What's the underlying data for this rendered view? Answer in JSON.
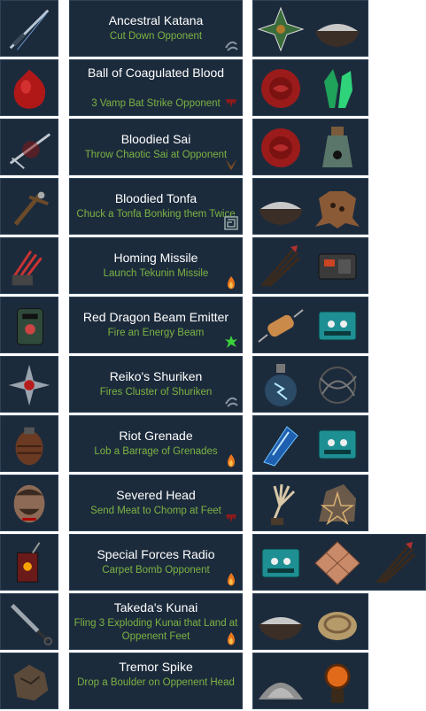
{
  "recipes": [
    {
      "name": "Ancestral Katana",
      "desc": "Cut Down Opponent",
      "icon": "katana-icon",
      "element": "wind-icon",
      "ingredients": [
        "shuriken-star-icon",
        "salt-bowl-icon"
      ]
    },
    {
      "name": "Ball of Coagulated Blood",
      "desc": "3 Vamp Bat Strike Opponent",
      "icon": "blood-ball-icon",
      "element": "blood-icon",
      "ingredients": [
        "wax-seal-icon",
        "green-crystal-icon"
      ]
    },
    {
      "name": "Bloodied Sai",
      "desc": "Throw Chaotic Sai at Opponent",
      "icon": "sai-icon",
      "element": "horns-icon",
      "ingredients": [
        "wax-seal-icon",
        "bottled-spider-icon"
      ]
    },
    {
      "name": "Bloodied Tonfa",
      "desc": "Chuck a Tonfa Bonking them Twice",
      "icon": "tonfa-icon",
      "element": "maze-icon",
      "ingredients": [
        "salt-bowl-icon",
        "animal-pelt-icon"
      ]
    },
    {
      "name": "Homing Missile",
      "desc": "Launch Tekunin Missile",
      "icon": "claws-icon",
      "element": "fire-icon",
      "ingredients": [
        "arrows-bundle-icon",
        "metal-device-icon"
      ]
    },
    {
      "name": "Red Dragon Beam Emitter",
      "desc": "Fire an Energy Beam",
      "icon": "emitter-device-icon",
      "element": "acid-icon",
      "ingredients": [
        "resistor-icon",
        "circuit-board-icon"
      ]
    },
    {
      "name": "Reiko's Shuriken",
      "desc": "Fires Cluster of Shuriken",
      "icon": "shuriken-icon",
      "element": "wind-icon",
      "ingredients": [
        "lightning-flask-icon",
        "tangled-wire-icon"
      ]
    },
    {
      "name": "Riot Grenade",
      "desc": "Lob a Barrage of Grenades",
      "icon": "grenade-icon",
      "element": "fire-icon",
      "ingredients": [
        "energy-crystal-icon",
        "circuit-board-icon"
      ]
    },
    {
      "name": "Severed Head",
      "desc": "Send Meat to Chomp at Feet",
      "icon": "severed-head-icon",
      "element": "blood-icon",
      "ingredients": [
        "skeleton-hand-icon",
        "pentagram-rock-icon"
      ]
    },
    {
      "name": "Special Forces Radio",
      "desc": "Carpet Bomb Opponent",
      "icon": "radio-icon",
      "element": "fire-icon",
      "ingredients": [
        "circuit-board-icon",
        "copper-plate-icon",
        "arrows-bundle-icon"
      ]
    },
    {
      "name": "Takeda's Kunai",
      "desc": "Fling 3 Exploding Kunai that Land at Oppenent Feet",
      "icon": "kunai-icon",
      "element": "fire-icon",
      "ingredients": [
        "salt-bowl-icon",
        "rope-coil-icon"
      ]
    },
    {
      "name": "Tremor Spike",
      "desc": "Drop a Boulder on Oppenent Head",
      "icon": "boulder-icon",
      "element": "",
      "ingredients": [
        "ash-pile-icon",
        "lantern-orb-icon"
      ]
    }
  ]
}
